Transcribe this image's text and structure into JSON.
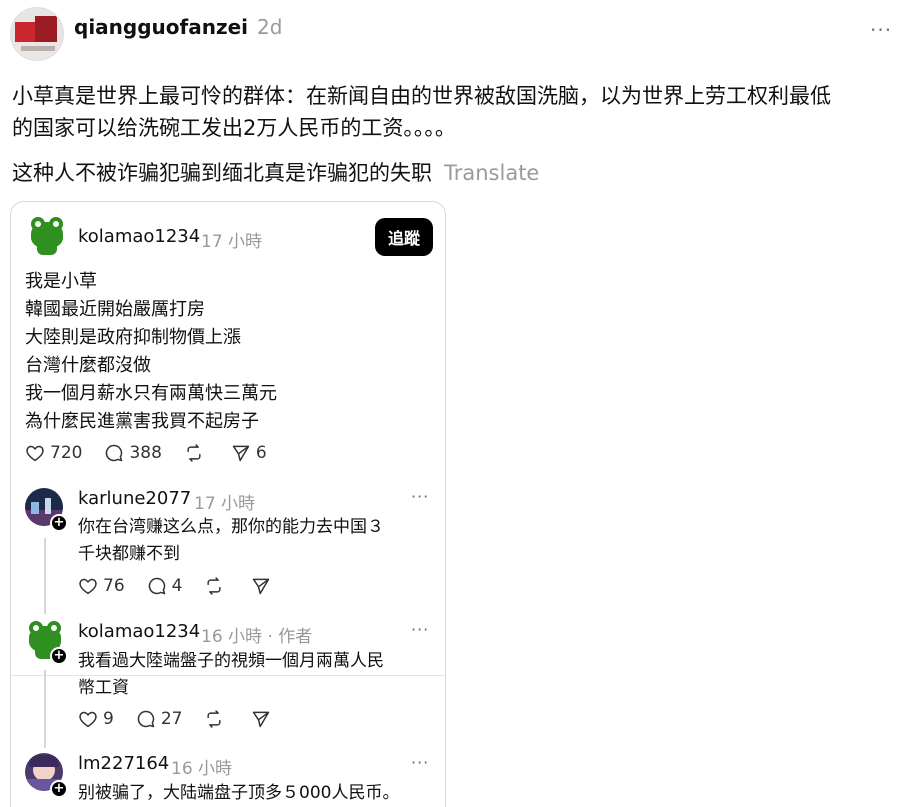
{
  "post": {
    "username": "qiangguofanzei",
    "time": "2d",
    "more": "···",
    "text_line1": "小草真是世界上最可怜的群体：在新闻自由的世界被敌国洗脑，以为世界上劳工权利最低",
    "text_line2": "的国家可以给洗碗工发出2万人民币的工资。。。。",
    "text_line3": "这种人不被诈骗犯骗到缅北真是诈骗犯的失职",
    "translate": "Translate"
  },
  "quote": {
    "username": "kolamao1234",
    "time": "17 小時",
    "follow_label": "追蹤",
    "lines": [
      "我是小草",
      "韓國最近開始嚴厲打房",
      "大陸則是政府抑制物價上漲",
      "台灣什麼都沒做",
      "我一個月薪水只有兩萬快三萬元",
      "為什麼民進黨害我買不起房子"
    ],
    "likes": "720",
    "comments": "388",
    "shares": "6"
  },
  "replies": [
    {
      "username": "karlune2077",
      "time": "17 小時",
      "line1": "你在台湾赚这么点，那你的能力去中国３",
      "line2": "千块都赚不到",
      "likes": "76",
      "comments": "4"
    },
    {
      "username": "kolamao1234",
      "time": "16 小時 · 作者",
      "line1": "我看過大陸端盤子的視頻一個月兩萬人民",
      "line2": "幣工資",
      "likes": "9",
      "comments": "27"
    },
    {
      "username": "lm227164",
      "time": "16 小時",
      "line1": "别被骗了，大陆端盘子顶多５000人民币。",
      "line2": ""
    }
  ],
  "icons": {
    "more": "more-dots-icon",
    "like": "heart-icon",
    "comment": "comment-bubble-icon",
    "repost": "repost-icon",
    "share": "send-icon",
    "follow_badge": "plus-icon"
  }
}
